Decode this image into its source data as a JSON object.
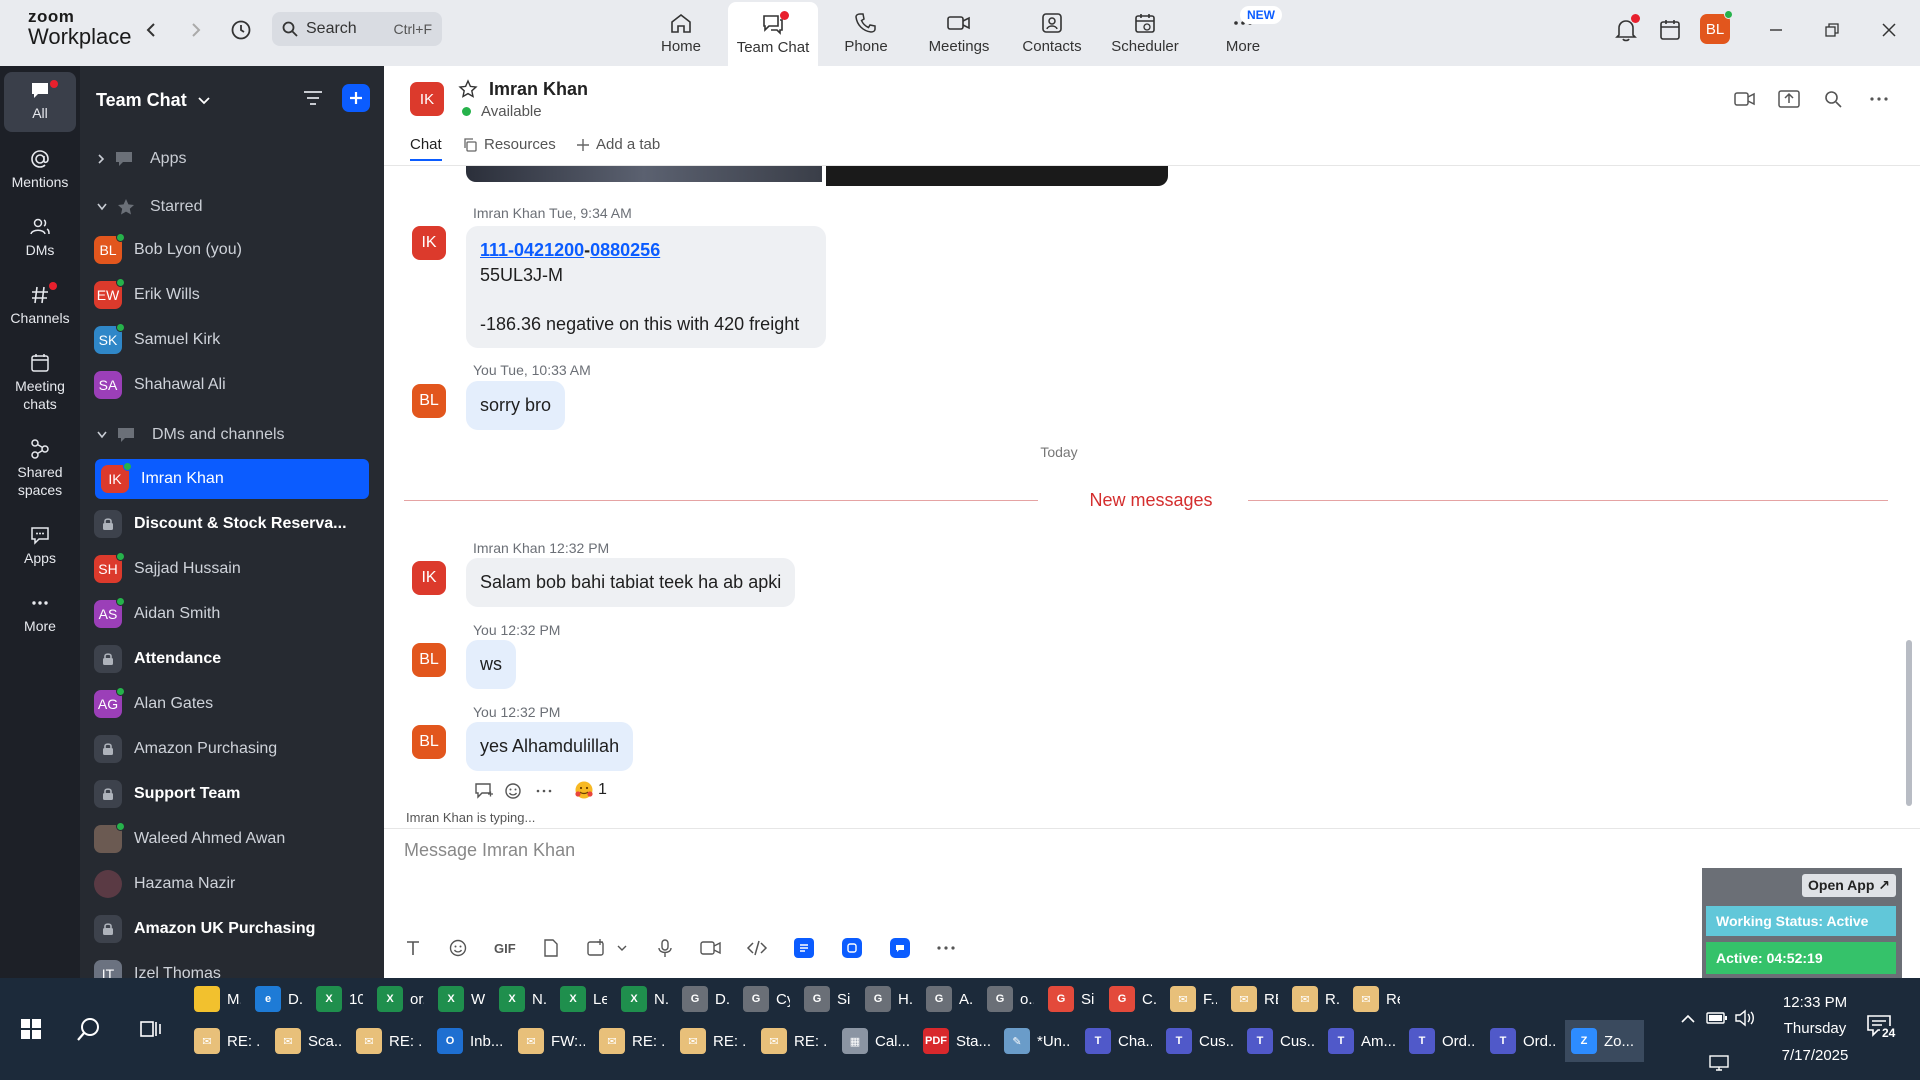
{
  "app": {
    "logo_top": "zoom",
    "logo_bottom": "Workplace"
  },
  "search": {
    "placeholder": "Search",
    "shortcut": "Ctrl+F"
  },
  "nav_tabs": [
    {
      "label": "Home",
      "icon": "home-icon"
    },
    {
      "label": "Team Chat",
      "icon": "chat-icon"
    },
    {
      "label": "Phone",
      "icon": "phone-icon"
    },
    {
      "label": "Meetings",
      "icon": "video-icon"
    },
    {
      "label": "Contacts",
      "icon": "contacts-icon"
    },
    {
      "label": "Scheduler",
      "icon": "calendar-icon"
    },
    {
      "label": "More",
      "icon": "more-icon",
      "badge": "NEW"
    }
  ],
  "user_avatar": "BL",
  "rail": [
    {
      "label": "All"
    },
    {
      "label": "Mentions"
    },
    {
      "label": "DMs"
    },
    {
      "label": "Channels"
    },
    {
      "label": "Meeting chats"
    },
    {
      "label": "Shared spaces"
    },
    {
      "label": "Apps"
    },
    {
      "label": "More"
    }
  ],
  "sidebar": {
    "title": "Team Chat",
    "apps_label": "Apps",
    "starred_label": "Starred",
    "starred": [
      {
        "initials": "BL",
        "name": "Bob Lyon (you)",
        "color": "#e2561d"
      },
      {
        "initials": "EW",
        "name": "Erik Wills",
        "color": "#dc3a2c"
      },
      {
        "initials": "SK",
        "name": "Samuel Kirk",
        "color": "#2f87c8"
      },
      {
        "initials": "SA",
        "name": "Shahawal Ali",
        "color": "#9b3fb8"
      }
    ],
    "dms_label": "DMs and channels",
    "dms": [
      {
        "initials": "IK",
        "name": "Imran Khan",
        "type": "person",
        "color": "#dc3a2c",
        "active": true
      },
      {
        "name": "Discount & Stock Reserva...",
        "type": "channel",
        "bold": true
      },
      {
        "initials": "SH",
        "name": "Sajjad Hussain",
        "type": "person",
        "color": "#dc3a2c"
      },
      {
        "initials": "AS",
        "name": "Aidan Smith",
        "type": "person",
        "color": "#9b3fb8"
      },
      {
        "name": "Attendance",
        "type": "channel",
        "bold": true
      },
      {
        "initials": "AG",
        "name": "Alan Gates",
        "type": "person",
        "color": "#9b3fb8"
      },
      {
        "name": "Amazon Purchasing",
        "type": "channel"
      },
      {
        "name": "Support Team",
        "type": "channel",
        "bold": true
      },
      {
        "initials": "",
        "name": "Waleed Ahmed Awan",
        "type": "person",
        "color": "#6b5a52"
      },
      {
        "initials": "",
        "name": "Hazama Nazir",
        "type": "person",
        "color": "#5a3a44"
      },
      {
        "name": "Amazon UK Purchasing",
        "type": "channel",
        "bold": true
      },
      {
        "initials": "IT",
        "name": "Izel Thomas",
        "type": "person",
        "color": "#6b7280"
      }
    ]
  },
  "chat": {
    "contact_initials": "IK",
    "contact_name": "Imran Khan",
    "status": "Available",
    "tabs": [
      "Chat",
      "Resources",
      "Add a tab"
    ],
    "messages": [
      {
        "sender": "Imran Khan",
        "time": "Tue, 9:34 AM",
        "avatar": "IK",
        "link1": "111-0421200",
        "sep": "-",
        "link2": "0880256",
        "line2": "55UL3J-M",
        "line3": "-186.36 negative  on this  with 420 freight"
      },
      {
        "sender": "You",
        "time": "Tue, 10:33 AM",
        "avatar": "BL",
        "text": "sorry bro"
      },
      {
        "sender": "Imran Khan",
        "time": "12:32 PM",
        "avatar": "IK",
        "text": "Salam bob bahi  tabiat teek ha ab apki"
      },
      {
        "sender": "You",
        "time": "12:32 PM",
        "avatar": "BL",
        "text": "ws"
      },
      {
        "sender": "You",
        "time": "12:32 PM",
        "avatar": "BL",
        "text": "yes Alhamdulillah"
      }
    ],
    "date_divider": "Today",
    "new_messages": "New messages",
    "reaction_count": "1",
    "typing": "Imran Khan is typing...",
    "composer_placeholder": "Message Imran Khan",
    "gif_label": "GIF"
  },
  "widget": {
    "open_app": "Open App ↗",
    "working_status": "Working Status: Active",
    "active_timer": "Active: 04:52:19"
  },
  "taskbar": {
    "row1": [
      "M...",
      "D...",
      "10...",
      "or...",
      "W...",
      "N...",
      "Le...",
      "N...",
      "D...",
      "Cy...",
      "Si...",
      "H...",
      "A...",
      "o...",
      "Si...",
      "C...",
      "F...",
      "RE...",
      "R...",
      "Re..."
    ],
    "row2": [
      "RE: ...",
      "Sca...",
      "RE: ...",
      "Inb...",
      "FW:...",
      "RE: ...",
      "RE: ...",
      "RE: ...",
      "Cal...",
      "Sta...",
      "*Un...",
      "Cha...",
      "Cus...",
      "Cus...",
      "Am...",
      "Ord...",
      "Ord...",
      "Zo..."
    ],
    "time": "12:33 PM",
    "day": "Thursday",
    "date": "7/17/2025",
    "notif_count": "24"
  }
}
